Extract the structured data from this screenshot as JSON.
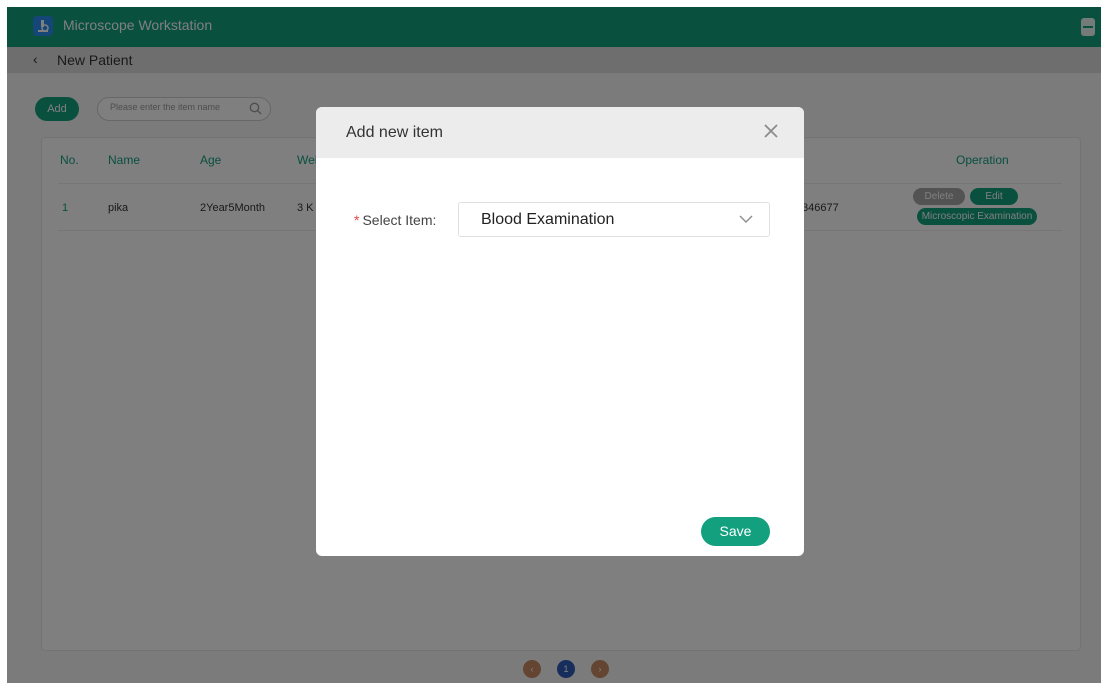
{
  "app": {
    "title": "Microscope Workstation"
  },
  "subheader": {
    "title": "New Patient"
  },
  "toolbar": {
    "add_label": "Add",
    "search_placeholder": "Please enter the item name"
  },
  "table": {
    "headers": [
      "No.",
      "Name",
      "Age",
      "Wei",
      "Operation"
    ],
    "rows": [
      {
        "no": "1",
        "name": "pika",
        "age": "2Year5Month",
        "weight": "3 K",
        "phone": "346677"
      }
    ],
    "actions": {
      "delete": "Delete",
      "edit": "Edit",
      "microscopic": "Microscopic Examination"
    }
  },
  "pagination": {
    "prev": "‹",
    "current": "1",
    "next": "›"
  },
  "modal": {
    "title": "Add new item",
    "required_mark": "*",
    "field_label": "Select Item:",
    "selected_value": "Blood Examination",
    "save_label": "Save"
  },
  "colors": {
    "brand": "#12a07f",
    "required": "#e64545",
    "page_active": "#2f5bb8",
    "page_inactive": "#c98a63"
  }
}
